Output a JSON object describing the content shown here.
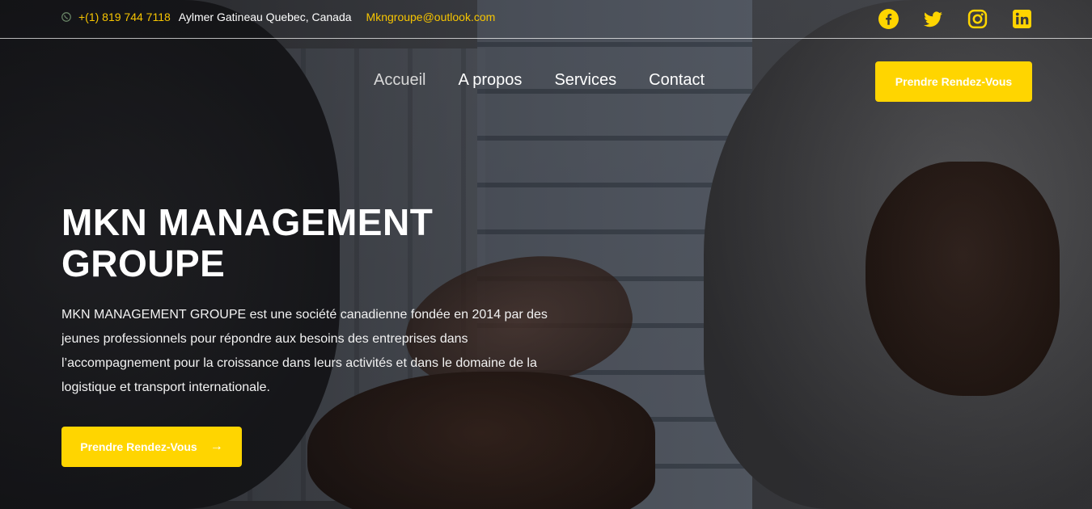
{
  "topbar": {
    "phone": "+(1) 819 744 7118",
    "address": "Aylmer Gatineau Quebec, Canada",
    "email": "Mkngroupe@outlook.com",
    "social": [
      "facebook-icon",
      "twitter-icon",
      "instagram-icon",
      "linkedin-icon"
    ]
  },
  "nav": {
    "items": [
      "Accueil",
      "A propos",
      "Services",
      "Contact"
    ],
    "cta": "Prendre Rendez-Vous"
  },
  "hero": {
    "title": "MKN MANAGEMENT GROUPE",
    "description": "MKN MANAGEMENT GROUPE est une société canadienne fondée en 2014 par des jeunes professionnels pour répondre aux besoins des entreprises dans l’accompagnement pour la croissance dans leurs activités et dans le domaine de la logistique et transport internationale.",
    "cta": "Prendre Rendez-Vous",
    "cta_icon": "arrow-right-icon"
  },
  "colors": {
    "accent": "#ffd500",
    "text": "#ffffff"
  }
}
